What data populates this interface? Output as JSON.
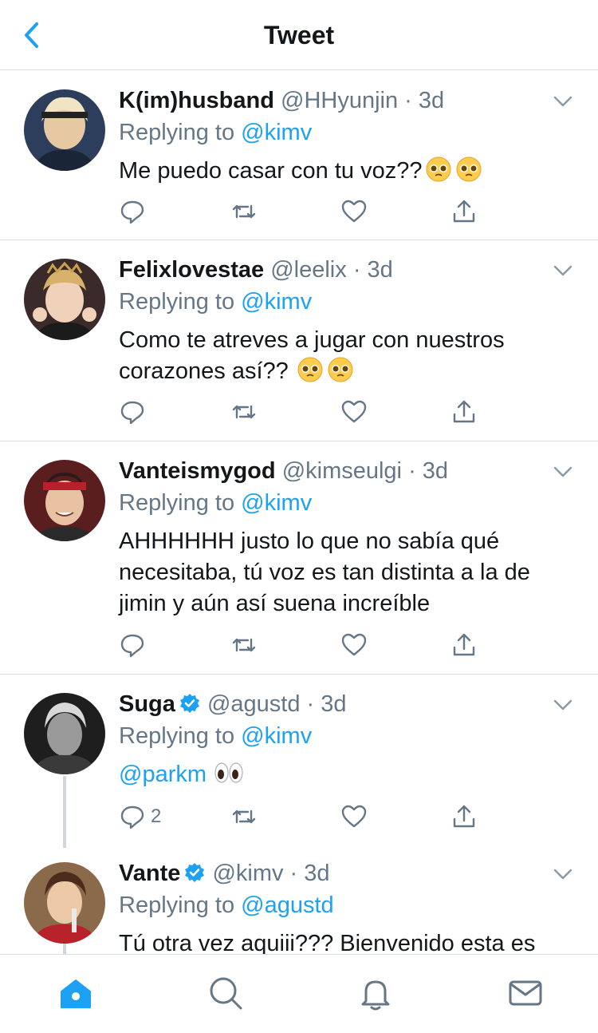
{
  "header": {
    "title": "Tweet"
  },
  "tweets": [
    {
      "name": "K(im)husband",
      "handle": "@HHyunjin",
      "time": "3d",
      "reply_prefix": "Replying to",
      "reply_to": "@kimv",
      "text": "Me puedo casar con tu voz??",
      "emoji": "pleading-face-emoji",
      "verified": false,
      "reply_count": ""
    },
    {
      "name": "Felixlovestae",
      "handle": "@leelix",
      "time": "3d",
      "reply_prefix": "Replying to",
      "reply_to": "@kimv",
      "text_line1": "Como te atreves a jugar con nuestros",
      "text_line2": "corazones así??",
      "emoji": "pleading-face-emoji",
      "verified": false,
      "reply_count": ""
    },
    {
      "name": "Vanteismygod",
      "handle": "@kimseulgi",
      "time": "3d",
      "reply_prefix": "Replying to",
      "reply_to": "@kimv",
      "text_line1": "AHHHHHH justo lo que no sabía qué",
      "text_line2": "necesitaba, tú voz es tan distinta a la de",
      "text_line3": "jimin y aún así suena increíble",
      "verified": false,
      "reply_count": ""
    },
    {
      "name": "Suga",
      "handle": "@agustd",
      "time": "3d",
      "reply_prefix": "Replying to",
      "reply_to": "@kimv",
      "text_mention": "@parkm",
      "emoji": "eyes-emoji",
      "verified": true,
      "reply_count": "2"
    },
    {
      "name": "Vante",
      "handle": "@kimv",
      "time": "3d",
      "reply_prefix": "Replying to",
      "reply_to": "@agustd",
      "text": "Tú otra vez aquiii??? Bienvenido esta es",
      "verified": true,
      "reply_count": ""
    }
  ],
  "separator": "·",
  "tabs": [
    "home-icon",
    "search-icon",
    "notifications-icon",
    "messages-icon"
  ],
  "colors": {
    "accent": "#1da1f2",
    "secondary_text": "#657786",
    "divider": "#d9dee2"
  }
}
